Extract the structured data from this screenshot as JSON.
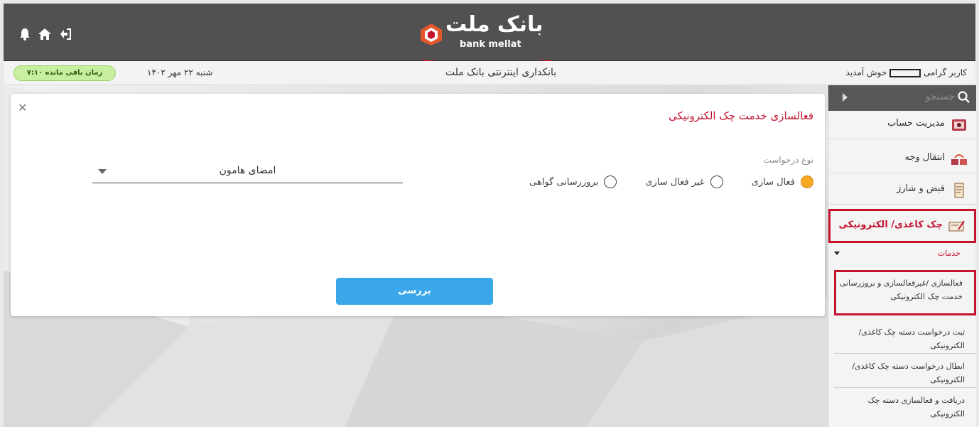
{
  "header": {
    "logo_fa": "بانک ملت",
    "logo_en": "bank mellat",
    "icons": [
      "bell-icon",
      "home-icon",
      "logout-icon"
    ]
  },
  "subheader": {
    "welcome_prefix": "کاربر گرامی",
    "welcome_suffix": "خوش آمدید",
    "title": "بانکداری اینترنتی بانک ملت",
    "date": "شنبه ۲۲ مهر ۱۴۰۲",
    "timer": "زمان باقی مانده ۷:۱۰"
  },
  "modal": {
    "title": "فعالسازی خدمت چک الکترونیکی",
    "request_type_label": "نوع درخواست",
    "radio_options": [
      "فعال سازی",
      "غیر فعال سازی",
      "بروزرسانی گواهی"
    ],
    "selected_option": "فعال سازی",
    "select_value": "امضای هامون",
    "submit_label": "بررسی"
  },
  "sidebar": {
    "search_placeholder": "جستجو",
    "items": [
      "مدیریت حساب",
      "انتقال وجه",
      "قبض و شارژ",
      "چک کاغذی/ الکترونیکی"
    ],
    "submenu_heading": "خدمات",
    "submenu_items": [
      "فعالسازی /غیرفعالسازی و بروزرسانی خدمت چک الکترونیکی",
      "ثبت درخواست دسته چک کاغذی/ الکترونیکی",
      "ابطال درخواست دسته چک کاغذی/ الکترونیکی",
      "دریافت و فعالسازی دسته چک الکترونیکی"
    ]
  },
  "colors": {
    "brand_red": "#c4122f",
    "header_bg": "#515151",
    "timer_bg": "#c8ef9f",
    "button_blue": "#3aa7e8",
    "radio_selected": "#f7a823"
  }
}
